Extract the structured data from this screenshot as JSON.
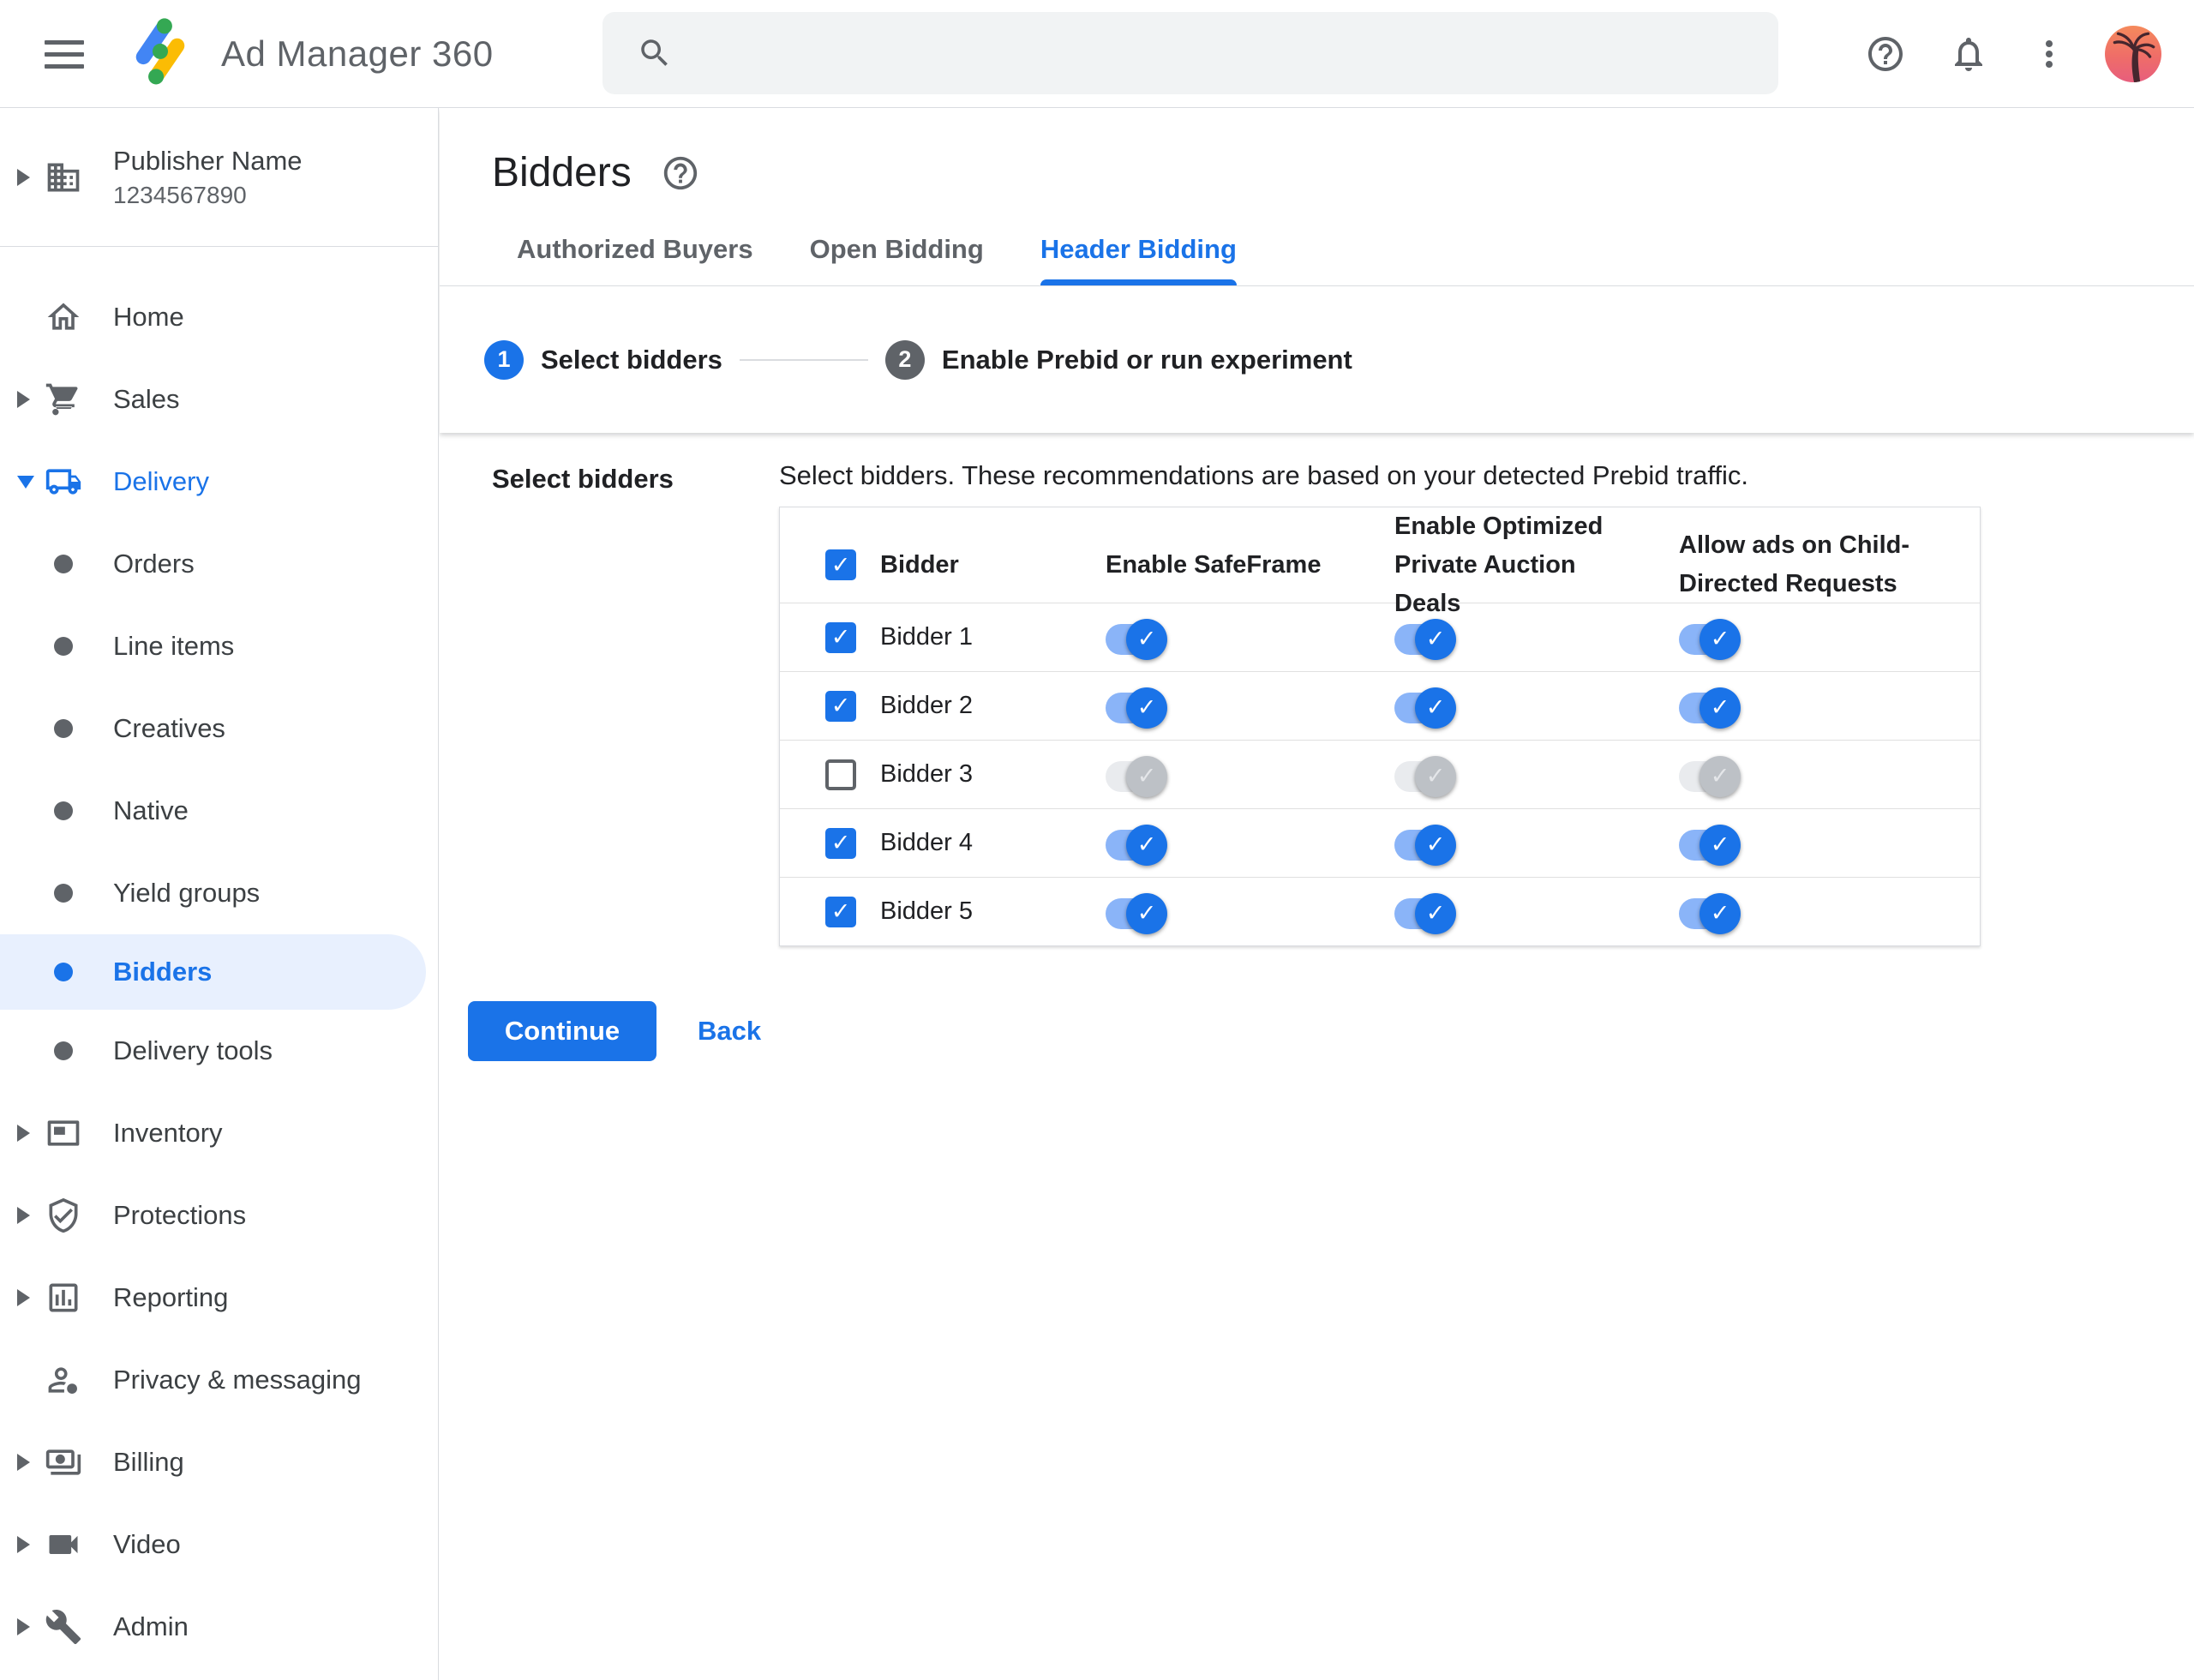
{
  "topbar": {
    "app_name": "Ad Manager 360",
    "search": {
      "placeholder": "",
      "icon": "search-icon"
    },
    "right_icons": [
      "help-icon",
      "notifications-icon",
      "more-options-icon",
      "account-avatar"
    ]
  },
  "sidebar": {
    "publisher": {
      "name": "Publisher Name",
      "id": "1234567890"
    },
    "items": [
      {
        "label": "Home",
        "type": "root",
        "icon": "home",
        "arrow": null,
        "selected": false,
        "section_active": false
      },
      {
        "label": "Sales",
        "type": "root",
        "icon": "cart",
        "arrow": "right",
        "selected": false,
        "section_active": false
      },
      {
        "label": "Delivery",
        "type": "root",
        "icon": "truck",
        "arrow": "down",
        "selected": false,
        "section_active": true
      },
      {
        "label": "Orders",
        "type": "sub",
        "icon": "bullet",
        "arrow": null,
        "selected": false,
        "section_active": false
      },
      {
        "label": "Line items",
        "type": "sub",
        "icon": "bullet",
        "arrow": null,
        "selected": false,
        "section_active": false
      },
      {
        "label": "Creatives",
        "type": "sub",
        "icon": "bullet",
        "arrow": null,
        "selected": false,
        "section_active": false
      },
      {
        "label": "Native",
        "type": "sub",
        "icon": "bullet",
        "arrow": null,
        "selected": false,
        "section_active": false
      },
      {
        "label": "Yield groups",
        "type": "sub",
        "icon": "bullet",
        "arrow": null,
        "selected": false,
        "section_active": false
      },
      {
        "label": "Bidders",
        "type": "sub",
        "icon": "bullet",
        "arrow": null,
        "selected": true,
        "section_active": false
      },
      {
        "label": "Delivery tools",
        "type": "sub",
        "icon": "bullet",
        "arrow": null,
        "selected": false,
        "section_active": false
      },
      {
        "label": "Inventory",
        "type": "root",
        "icon": "inventory",
        "arrow": "right",
        "selected": false,
        "section_active": false
      },
      {
        "label": "Protections",
        "type": "root",
        "icon": "shield",
        "arrow": "right",
        "selected": false,
        "section_active": false
      },
      {
        "label": "Reporting",
        "type": "root",
        "icon": "report",
        "arrow": "right",
        "selected": false,
        "section_active": false
      },
      {
        "label": "Privacy & messaging",
        "type": "root",
        "icon": "privacy",
        "arrow": null,
        "selected": false,
        "section_active": false
      },
      {
        "label": "Billing",
        "type": "root",
        "icon": "billing",
        "arrow": "right",
        "selected": false,
        "section_active": false
      },
      {
        "label": "Video",
        "type": "root",
        "icon": "video",
        "arrow": "right",
        "selected": false,
        "section_active": false
      },
      {
        "label": "Admin",
        "type": "root",
        "icon": "admin",
        "arrow": "right",
        "selected": false,
        "section_active": false
      }
    ]
  },
  "page": {
    "title": "Bidders",
    "help_icon": "help-icon",
    "tabs": [
      {
        "label": "Authorized Buyers",
        "active": false
      },
      {
        "label": "Open Bidding",
        "active": false
      },
      {
        "label": "Header Bidding",
        "active": true
      }
    ],
    "stepper": [
      {
        "num": "1",
        "label": "Select bidders",
        "active": true
      },
      {
        "num": "2",
        "label": "Enable Prebid or run experiment",
        "active": false
      }
    ]
  },
  "content": {
    "section_label": "Select bidders",
    "description": "Select bidders. These recommendations are based on your detected Prebid traffic.",
    "table": {
      "columns": [
        "Bidder",
        "Enable SafeFrame",
        "Enable Optimized Private Auction Deals",
        "Allow ads on Child-Directed Requests"
      ],
      "header_checkbox_checked": true,
      "rows": [
        {
          "name": "Bidder 1",
          "checked": true,
          "toggles": [
            true,
            true,
            true
          ]
        },
        {
          "name": "Bidder 2",
          "checked": true,
          "toggles": [
            true,
            true,
            true
          ]
        },
        {
          "name": "Bidder 3",
          "checked": false,
          "toggles": [
            false,
            false,
            false
          ]
        },
        {
          "name": "Bidder 4",
          "checked": true,
          "toggles": [
            true,
            true,
            true
          ]
        },
        {
          "name": "Bidder 5",
          "checked": true,
          "toggles": [
            true,
            true,
            true
          ]
        }
      ]
    },
    "buttons": {
      "continue": "Continue",
      "back": "Back"
    }
  },
  "colors": {
    "accent_blue": "#1a73e8",
    "selected_item_bg": "#e8f0fe",
    "toggle_on_track": "#8ab4f8",
    "toggle_off_track": "#e9ebee",
    "toggle_off_thumb": "#bdc1c6",
    "border_gray": "#dadce0",
    "text_primary": "#202124",
    "text_secondary": "#5f6368",
    "search_bg": "#f1f3f4",
    "logo_blue": "#4285f4",
    "logo_yellow": "#fbbc04",
    "logo_green": "#34a853"
  }
}
